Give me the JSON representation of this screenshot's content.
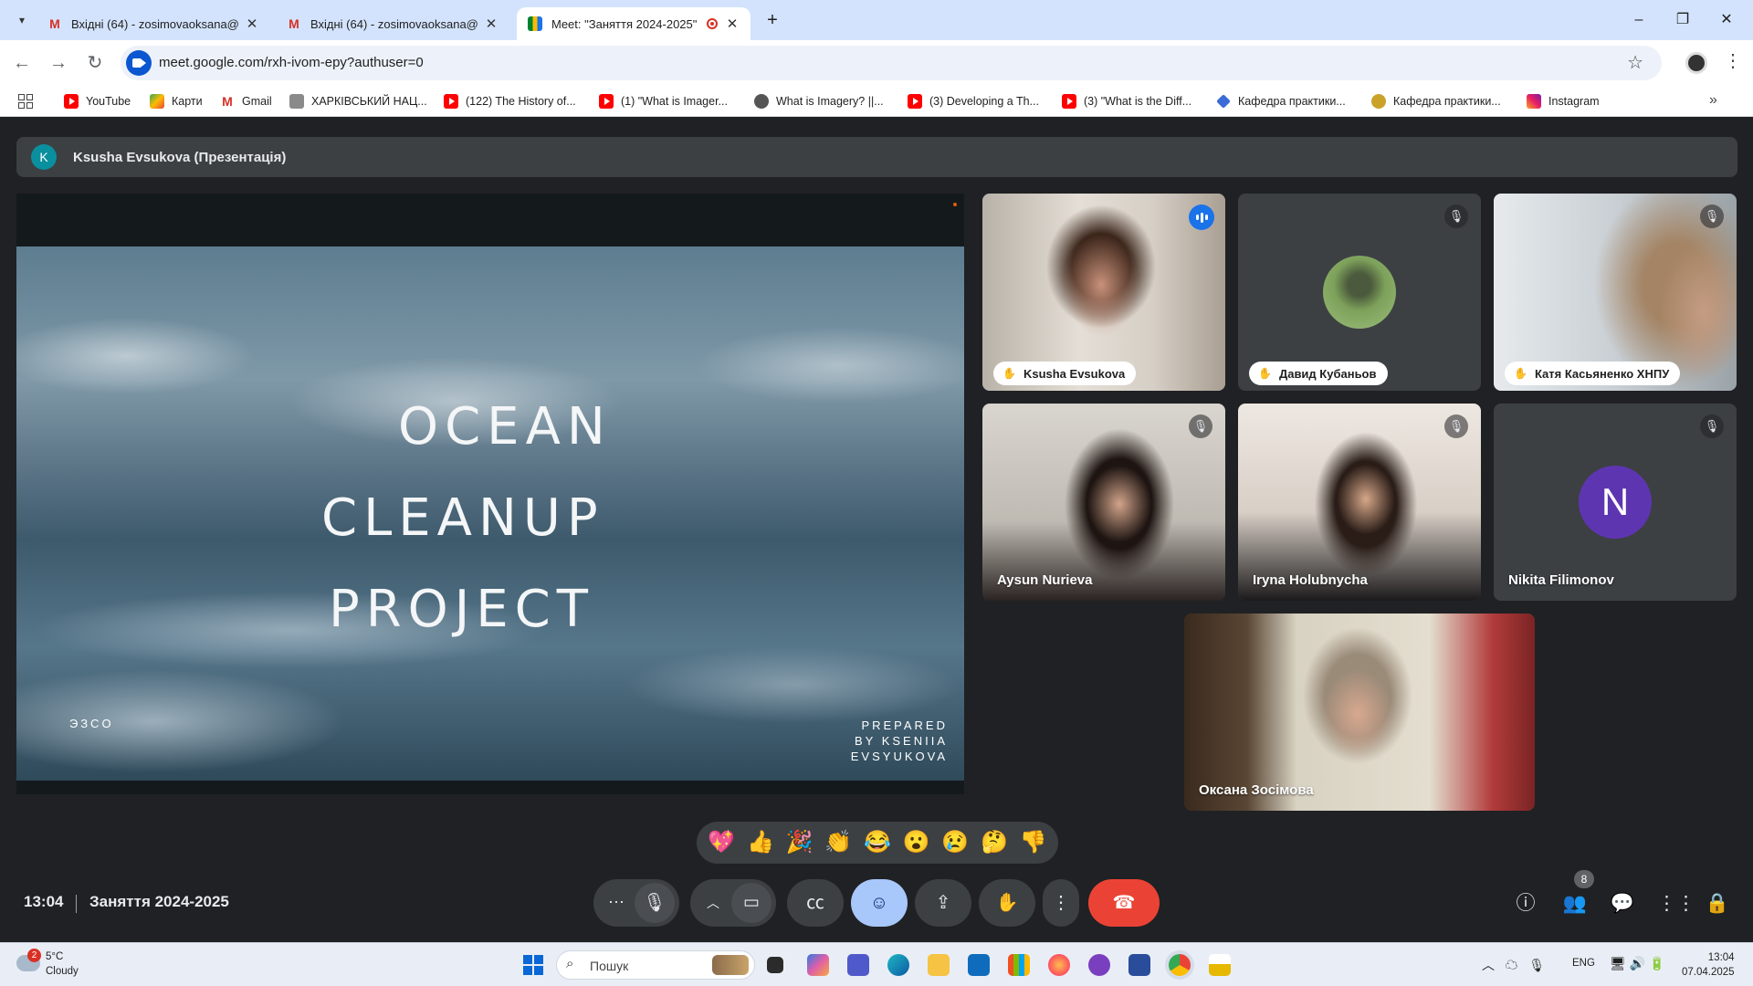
{
  "browser": {
    "tabs": [
      {
        "title": "Вхідні (64) - zosimovaoksana@"
      },
      {
        "title": "Вхідні (64) - zosimovaoksana@"
      },
      {
        "title": "Meet: \"Заняття 2024-2025\""
      }
    ],
    "new_tab": "+",
    "url": "meet.google.com/rxh-ivom-epy?authuser=0",
    "bookmarks": [
      "YouTube",
      "Карти",
      "Gmail",
      "ХАРКІВСЬКИЙ НАЦ...",
      "(122) The History of...",
      "(1) \"What is Imager...",
      "What is Imagery? ||...",
      "(3) Developing a Th...",
      "(3) \"What is the Diff...",
      "Кафедра практики...",
      "Кафедра практики...",
      "Instagram"
    ]
  },
  "meet": {
    "presenter_initial": "K",
    "presenter_label": "Ksusha Evsukova (Презентація)",
    "slide": {
      "title_lines": [
        "OCEAN",
        "CLEANUP",
        "PROJECT"
      ],
      "logo": "ЭЗCO",
      "credit_lines": [
        "PREPARED",
        "BY KSENIIA",
        "EVSYUKOVA"
      ]
    },
    "participants": [
      {
        "name": "Ksusha Evsukova",
        "speaking": true
      },
      {
        "name": "Давид Кубаньов"
      },
      {
        "name": "Катя Касьяненко ХНПУ"
      },
      {
        "name": "Aysun Nurieva"
      },
      {
        "name": "Iryna Holubnycha"
      },
      {
        "name": "Nikita Filimonov",
        "initial": "N"
      },
      {
        "name": "Оксана Зосімова"
      }
    ],
    "reactions": [
      "💖",
      "👍",
      "🎉",
      "👏",
      "😂",
      "😮",
      "😢",
      "🤔",
      "👎"
    ],
    "time": "13:04",
    "meeting_name": "Заняття 2024-2025",
    "people_count": "8"
  },
  "taskbar": {
    "weather_badge": "2",
    "temperature": "5°C",
    "condition": "Cloudy",
    "search_placeholder": "Пошук",
    "language": "ENG",
    "time": "13:04",
    "date": "07.04.2025"
  }
}
